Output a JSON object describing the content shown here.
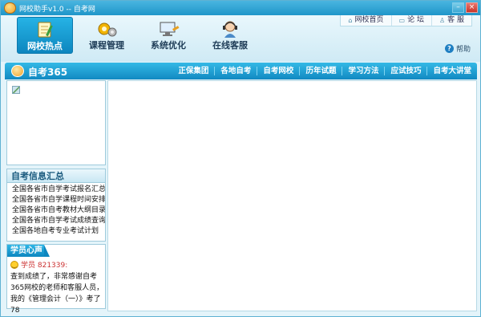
{
  "window": {
    "title": "网校助手v1.0 -- 自考网"
  },
  "header": {
    "links": [
      {
        "label": "网校首页",
        "icon": "home-icon"
      },
      {
        "label": "论  坛",
        "icon": "forum-icon"
      },
      {
        "label": "客  服",
        "icon": "user-icon"
      }
    ],
    "help_label": "帮助"
  },
  "nav": {
    "items": [
      {
        "label": "网校热点",
        "icon": "notebook-pencil-icon",
        "active": true
      },
      {
        "label": "课程管理",
        "icon": "gears-icon",
        "active": false
      },
      {
        "label": "系统优化",
        "icon": "computer-wrench-icon",
        "active": false
      },
      {
        "label": "在线客服",
        "icon": "headset-agent-icon",
        "active": false
      }
    ]
  },
  "sitebar": {
    "name": "自考365",
    "links": [
      "正保集团",
      "各地自考",
      "自考网校",
      "历年试题",
      "学习方法",
      "应试技巧",
      "自考大讲堂"
    ]
  },
  "info_panel": {
    "title": "自考信息汇总",
    "items": [
      "全国各省市自学考试报名汇总",
      "全国各省市自学课程时间安排",
      "全国各省市自考教材大纲目录",
      "全国各省市自学考试成绩查询",
      "全国各地自考专业考试计划"
    ]
  },
  "voice_panel": {
    "title": "学员心声",
    "user": "学员 821339:",
    "text": "查到成绩了，非常感谢自考365网校的老师和客服人员，我的《管理会计（一）》考了78"
  },
  "colors": {
    "accent": "#1189c2",
    "active_nav": "#0d86bf",
    "background": "#e4f4fa"
  }
}
